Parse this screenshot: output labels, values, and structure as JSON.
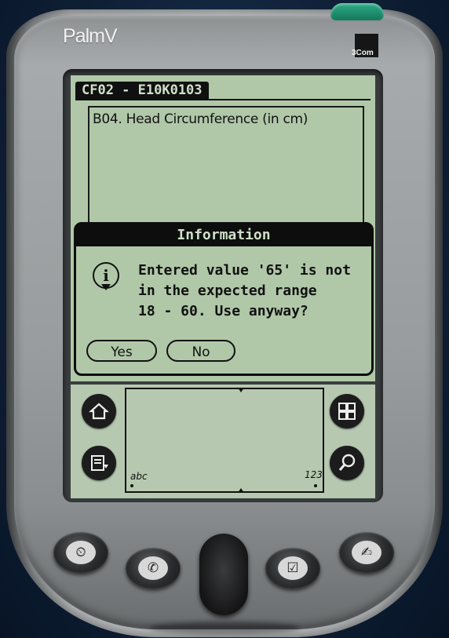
{
  "device": {
    "brand": "PalmV",
    "maker": "3Com"
  },
  "form": {
    "title": "CF02 - E10K0103",
    "field_label": "B04. Head Circumference (in cm)"
  },
  "dialog": {
    "title": "Information",
    "message_lines": [
      "Entered value '65' is not",
      "in the expected range",
      "18 - 60. Use anyway?"
    ],
    "yes_label": "Yes",
    "no_label": "No",
    "icon": "info-icon"
  },
  "graffiti": {
    "alpha_label": "abc",
    "numeric_label": "123",
    "silk_icons": [
      "home-icon",
      "menu-icon",
      "calculator-icon",
      "find-icon"
    ]
  },
  "hardware_buttons": [
    "datebook-icon",
    "phone-icon",
    "todo-icon",
    "memo-icon"
  ]
}
